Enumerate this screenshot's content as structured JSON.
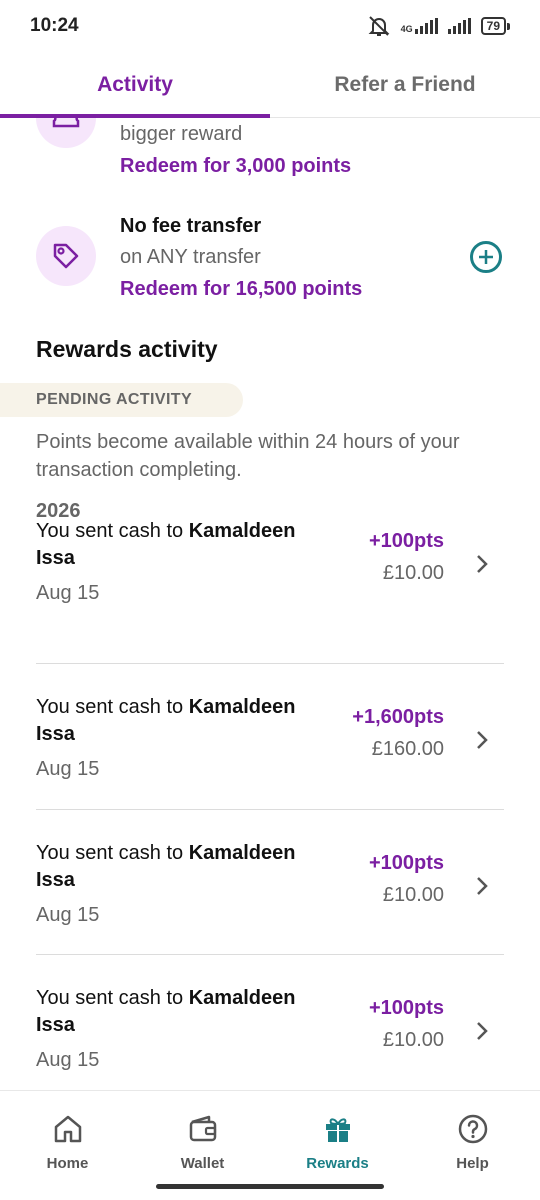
{
  "status_bar": {
    "time": "10:24",
    "network": "4G",
    "battery": "79"
  },
  "tabs": [
    {
      "label": "Activity",
      "active": true
    },
    {
      "label": "Refer a Friend",
      "active": false
    }
  ],
  "rewards": [
    {
      "icon": "ticket-icon",
      "title": "",
      "subtitle": "bigger reward",
      "redeem": "Redeem for 3,000 points"
    },
    {
      "icon": "tag-icon",
      "title": "No fee transfer",
      "subtitle": "on ANY transfer",
      "redeem": "Redeem for 16,500 points"
    }
  ],
  "activity": {
    "title": "Rewards activity",
    "pending_label": "PENDING ACTIVITY",
    "pending_note": "Points become available within 24 hours of your transaction completing.",
    "year": "2026",
    "transactions": [
      {
        "prefix": "You sent cash to ",
        "name": "Kamaldeen Issa",
        "date": "Aug 15",
        "points": "+100pts",
        "amount": "£10.00"
      },
      {
        "prefix": "You sent cash to ",
        "name": "Kamaldeen Issa",
        "date": "Aug 15",
        "points": "+1,600pts",
        "amount": "£160.00"
      },
      {
        "prefix": "You sent cash to ",
        "name": "Kamaldeen Issa",
        "date": "Aug 15",
        "points": "+100pts",
        "amount": "£10.00"
      },
      {
        "prefix": "You sent cash to ",
        "name": "Kamaldeen Issa",
        "date": "Aug 15",
        "points": "+100pts",
        "amount": "£10.00"
      }
    ]
  },
  "bottom_nav": [
    {
      "label": "Home",
      "icon": "home-icon",
      "active": false
    },
    {
      "label": "Wallet",
      "icon": "wallet-icon",
      "active": false
    },
    {
      "label": "Rewards",
      "icon": "gift-icon",
      "active": true
    },
    {
      "label": "Help",
      "icon": "help-icon",
      "active": false
    }
  ],
  "colors": {
    "brand_purple": "#7b1fa2",
    "accent_teal": "#1b7f86",
    "icon_bg": "#f6e6fb",
    "pending_bg": "#f7f3e9"
  }
}
